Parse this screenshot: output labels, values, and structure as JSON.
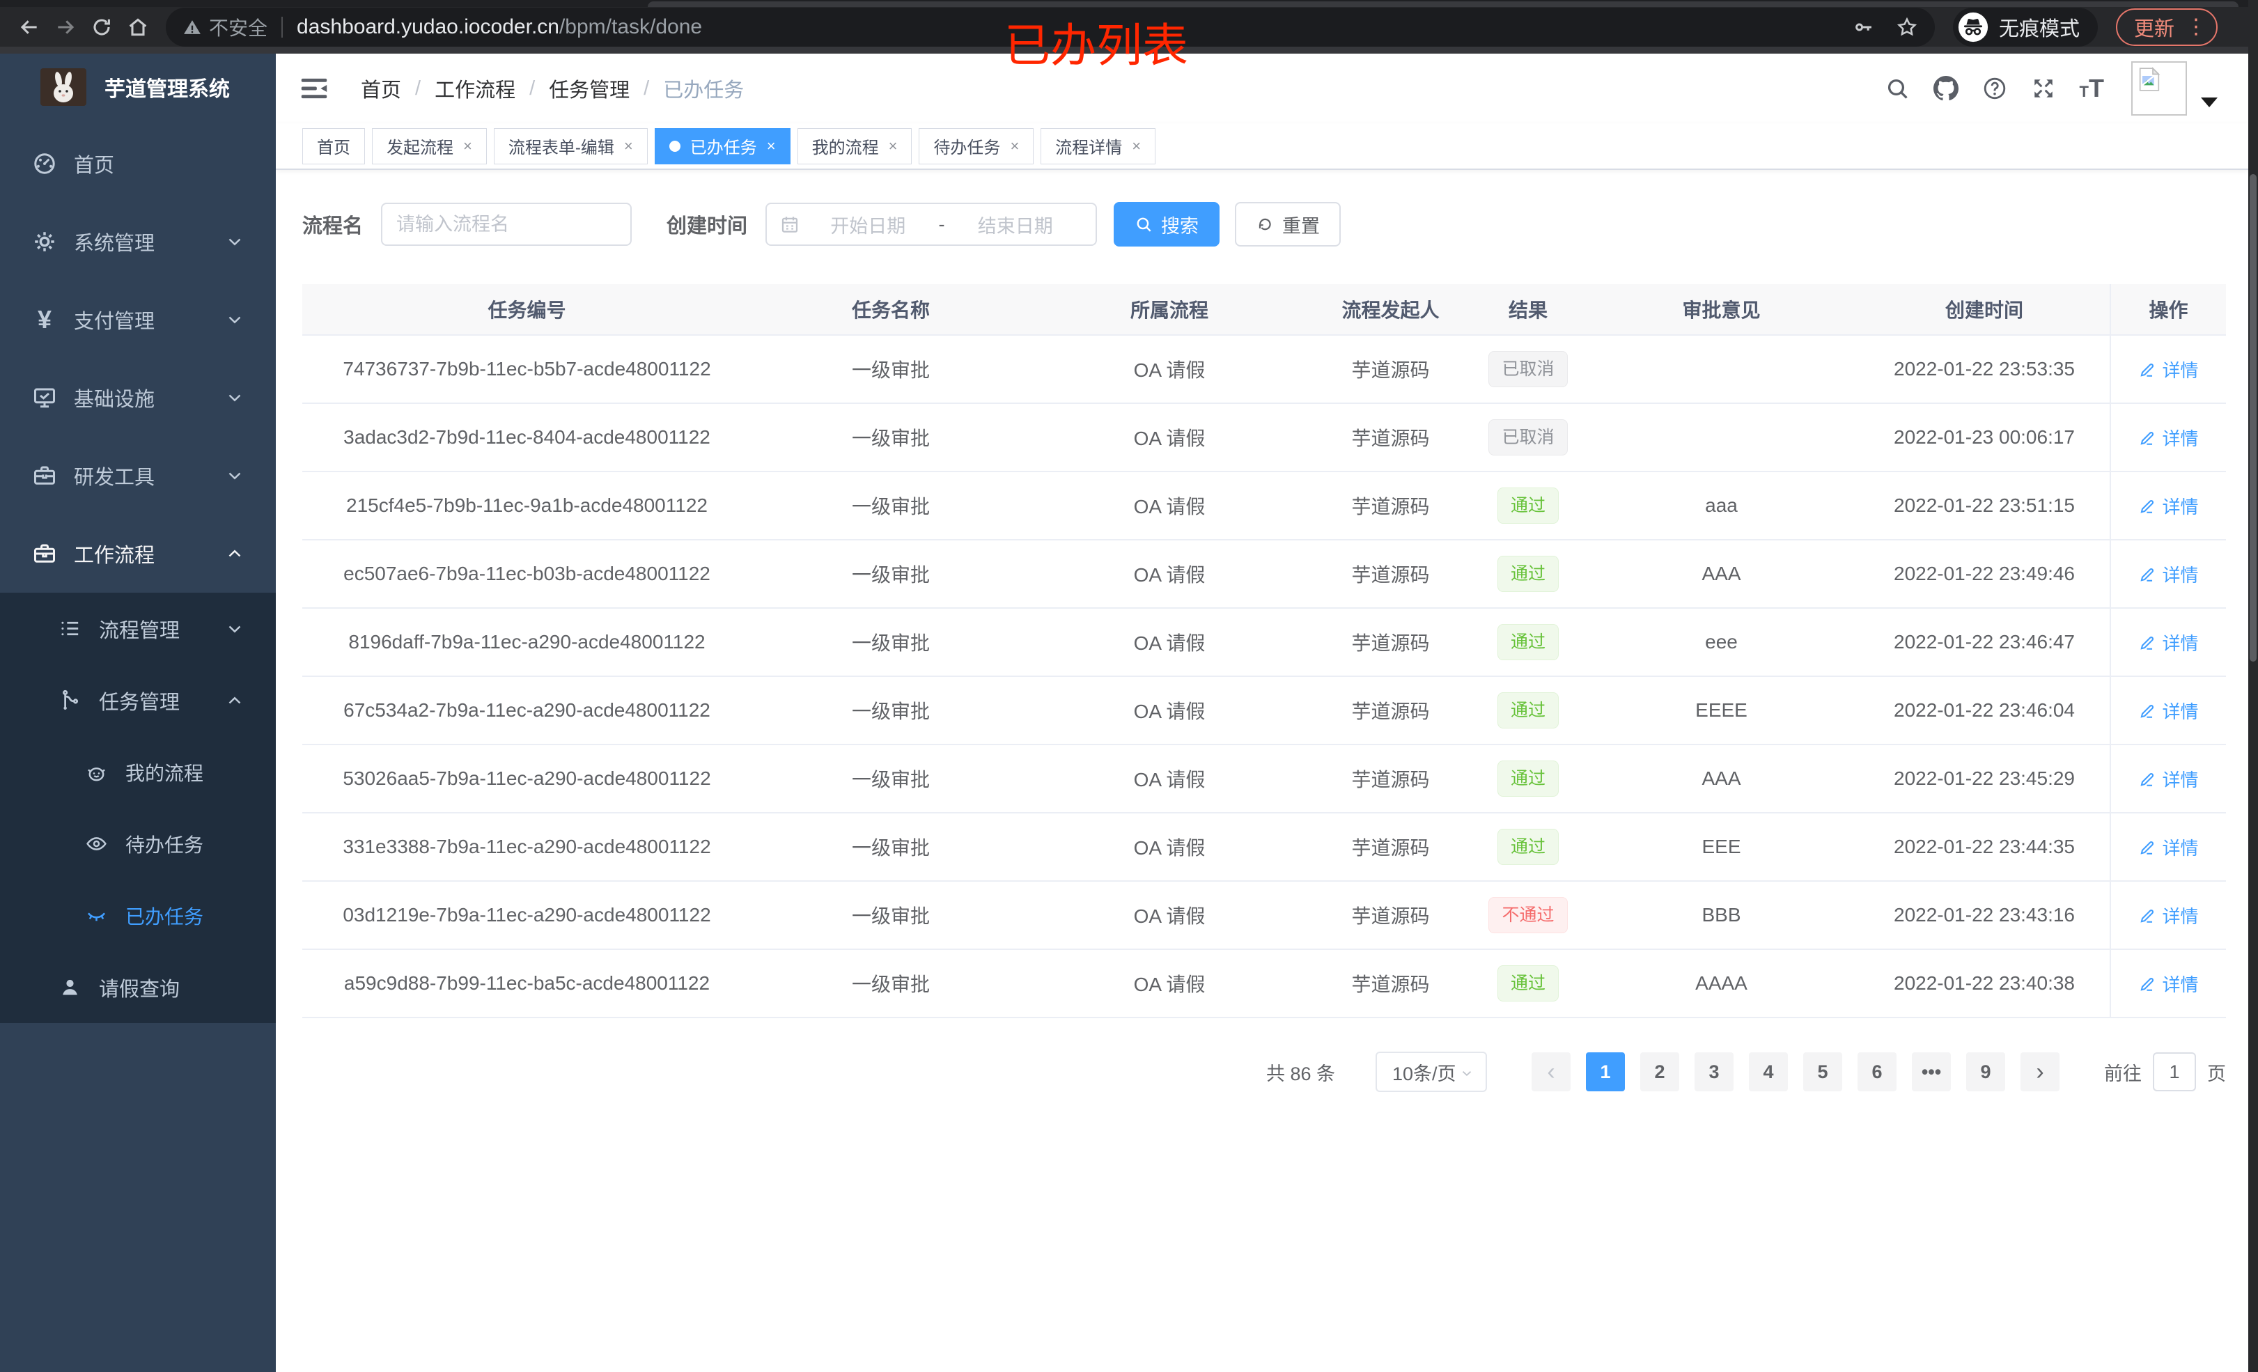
{
  "browser": {
    "security_label": "不安全",
    "url_host": "dashboard.yudao.iocoder.cn",
    "url_path": "/bpm/task/done",
    "incognito_label": "无痕模式",
    "update_label": "更新",
    "menu_dots": "⋮"
  },
  "annotation": {
    "text": "已办列表",
    "color": "#ff2600"
  },
  "sidebar": {
    "title": "芋道管理系统",
    "items": [
      {
        "name": "home",
        "label": "首页",
        "icon": "dashboard-icon",
        "level": 1
      },
      {
        "name": "system",
        "label": "系统管理",
        "icon": "gear-icon",
        "level": 1,
        "chevron": "down"
      },
      {
        "name": "payment",
        "label": "支付管理",
        "icon": "yen-icon",
        "level": 1,
        "chevron": "down"
      },
      {
        "name": "infra",
        "label": "基础设施",
        "icon": "monitor-icon",
        "level": 1,
        "chevron": "down"
      },
      {
        "name": "devtools",
        "label": "研发工具",
        "icon": "toolbox-icon",
        "level": 1,
        "chevron": "down"
      },
      {
        "name": "workflow",
        "label": "工作流程",
        "icon": "briefcase-icon",
        "level": 1,
        "chevron": "up",
        "parent_active": true
      },
      {
        "name": "process-mgmt",
        "label": "流程管理",
        "icon": "list-icon",
        "level": 2,
        "chevron": "down",
        "in_submenu": true
      },
      {
        "name": "task-mgmt",
        "label": "任务管理",
        "icon": "flow-icon",
        "level": 2,
        "chevron": "up",
        "in_submenu": true
      },
      {
        "name": "my-process",
        "label": "我的流程",
        "icon": "robot-icon",
        "level": 3,
        "in_submenu": true
      },
      {
        "name": "todo-tasks",
        "label": "待办任务",
        "icon": "eye-open-icon",
        "level": 3,
        "in_submenu": true
      },
      {
        "name": "done-tasks",
        "label": "已办任务",
        "icon": "eye-closed-icon",
        "level": 3,
        "in_submenu": true,
        "active": true
      },
      {
        "name": "leave-query",
        "label": "请假查询",
        "icon": "user-icon",
        "level": 2,
        "in_submenu": true
      }
    ]
  },
  "header": {
    "breadcrumb": [
      "首页",
      "工作流程",
      "任务管理",
      "已办任务"
    ]
  },
  "tabs": [
    {
      "name": "home",
      "label": "首页",
      "closable": false,
      "active": false
    },
    {
      "name": "start-process",
      "label": "发起流程",
      "closable": true,
      "active": false
    },
    {
      "name": "form-edit",
      "label": "流程表单-编辑",
      "closable": true,
      "active": false
    },
    {
      "name": "done-tasks",
      "label": "已办任务",
      "closable": true,
      "active": true
    },
    {
      "name": "my-process",
      "label": "我的流程",
      "closable": true,
      "active": false
    },
    {
      "name": "todo-tasks",
      "label": "待办任务",
      "closable": true,
      "active": false
    },
    {
      "name": "process-detail",
      "label": "流程详情",
      "closable": true,
      "active": false
    }
  ],
  "filters": {
    "name_label": "流程名",
    "name_placeholder": "请输入流程名",
    "time_label": "创建时间",
    "start_placeholder": "开始日期",
    "range_separator": "-",
    "end_placeholder": "结束日期",
    "search_label": "搜索",
    "reset_label": "重置"
  },
  "table": {
    "headers": [
      "任务编号",
      "任务名称",
      "所属流程",
      "流程发起人",
      "结果",
      "审批意见",
      "创建时间",
      "操作"
    ],
    "action_label": "详情",
    "rows": [
      {
        "id": "74736737-7b9b-11ec-b5b7-acde48001122",
        "name": "一级审批",
        "process": "OA 请假",
        "starter": "芋道源码",
        "result": "已取消",
        "result_type": "info",
        "comment": "",
        "created": "2022-01-22 23:53:35"
      },
      {
        "id": "3adac3d2-7b9d-11ec-8404-acde48001122",
        "name": "一级审批",
        "process": "OA 请假",
        "starter": "芋道源码",
        "result": "已取消",
        "result_type": "info",
        "comment": "",
        "created": "2022-01-23 00:06:17"
      },
      {
        "id": "215cf4e5-7b9b-11ec-9a1b-acde48001122",
        "name": "一级审批",
        "process": "OA 请假",
        "starter": "芋道源码",
        "result": "通过",
        "result_type": "success",
        "comment": "aaa",
        "created": "2022-01-22 23:51:15"
      },
      {
        "id": "ec507ae6-7b9a-11ec-b03b-acde48001122",
        "name": "一级审批",
        "process": "OA 请假",
        "starter": "芋道源码",
        "result": "通过",
        "result_type": "success",
        "comment": "AAA",
        "created": "2022-01-22 23:49:46"
      },
      {
        "id": "8196daff-7b9a-11ec-a290-acde48001122",
        "name": "一级审批",
        "process": "OA 请假",
        "starter": "芋道源码",
        "result": "通过",
        "result_type": "success",
        "comment": "eee",
        "created": "2022-01-22 23:46:47"
      },
      {
        "id": "67c534a2-7b9a-11ec-a290-acde48001122",
        "name": "一级审批",
        "process": "OA 请假",
        "starter": "芋道源码",
        "result": "通过",
        "result_type": "success",
        "comment": "EEEE",
        "created": "2022-01-22 23:46:04"
      },
      {
        "id": "53026aa5-7b9a-11ec-a290-acde48001122",
        "name": "一级审批",
        "process": "OA 请假",
        "starter": "芋道源码",
        "result": "通过",
        "result_type": "success",
        "comment": "AAA",
        "created": "2022-01-22 23:45:29"
      },
      {
        "id": "331e3388-7b9a-11ec-a290-acde48001122",
        "name": "一级审批",
        "process": "OA 请假",
        "starter": "芋道源码",
        "result": "通过",
        "result_type": "success",
        "comment": "EEE",
        "created": "2022-01-22 23:44:35"
      },
      {
        "id": "03d1219e-7b9a-11ec-a290-acde48001122",
        "name": "一级审批",
        "process": "OA 请假",
        "starter": "芋道源码",
        "result": "不通过",
        "result_type": "danger",
        "comment": "BBB",
        "created": "2022-01-22 23:43:16"
      },
      {
        "id": "a59c9d88-7b99-11ec-ba5c-acde48001122",
        "name": "一级审批",
        "process": "OA 请假",
        "starter": "芋道源码",
        "result": "通过",
        "result_type": "success",
        "comment": "AAAA",
        "created": "2022-01-22 23:40:38"
      }
    ]
  },
  "pagination": {
    "total_label": "共 86 条",
    "page_size": "10条/页",
    "prev_icon": "‹",
    "next_icon": "›",
    "pages": [
      "1",
      "2",
      "3",
      "4",
      "5",
      "6",
      "•••",
      "9"
    ],
    "active_page": "1",
    "goto_label": "前往",
    "goto_value": "1",
    "page_suffix": "页"
  },
  "colors": {
    "accent": "#409eff",
    "sidebar_bg": "#304156",
    "submenu_bg": "#1f2d3d",
    "success": "#67c23a",
    "danger": "#f56c6c",
    "info": "#909399",
    "annotation_red": "#ff2600"
  }
}
